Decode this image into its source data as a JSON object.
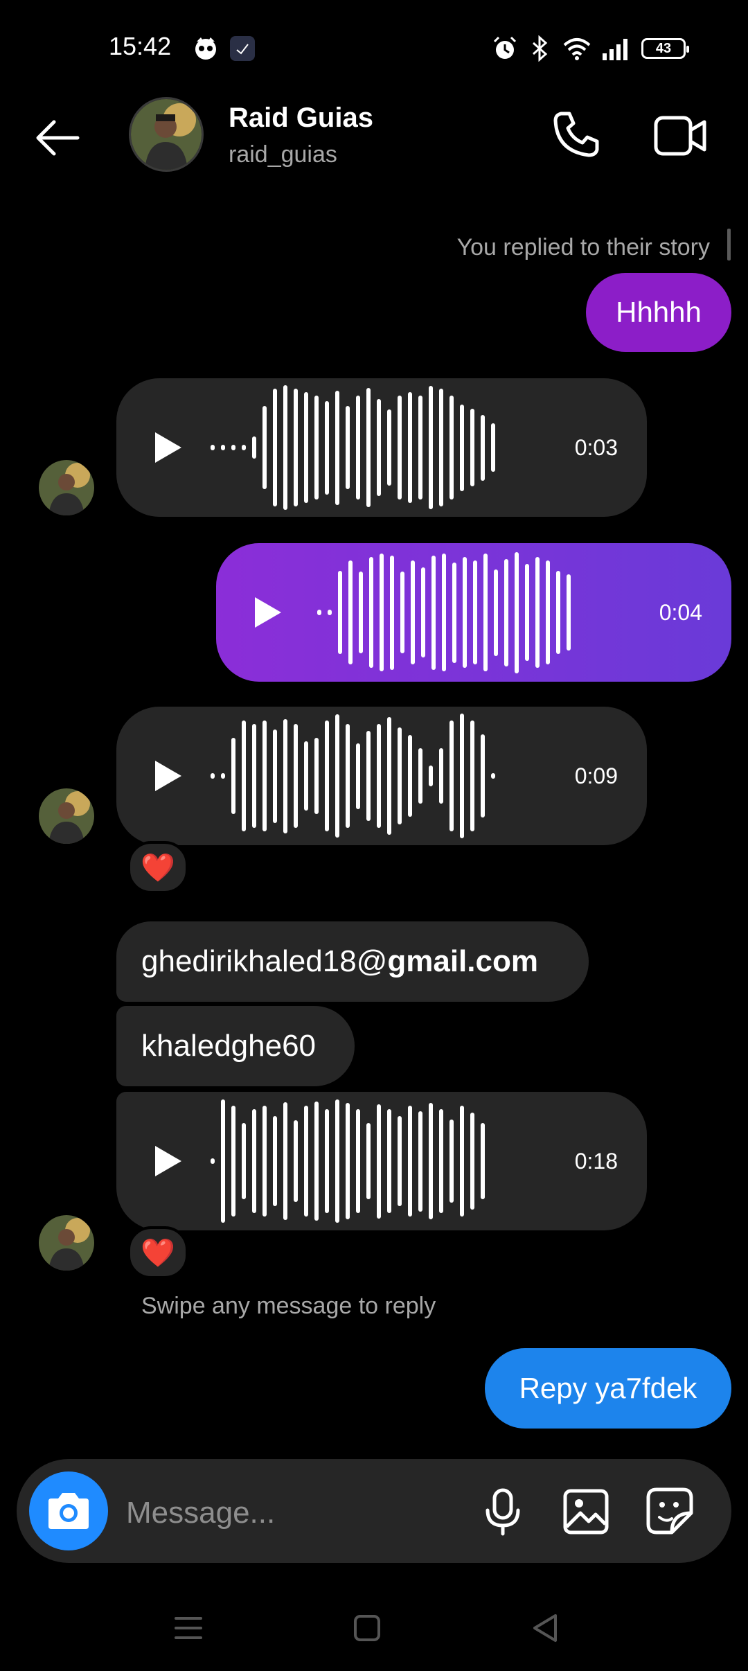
{
  "status_bar": {
    "time": "15:42",
    "battery": "43",
    "icons": [
      "app-notification-icon",
      "calendar-notification-icon",
      "alarm-icon",
      "bluetooth-icon",
      "wifi-icon",
      "signal-icon",
      "battery-icon"
    ]
  },
  "header": {
    "name": "Raid Guias",
    "username": "raid_guias",
    "icons": [
      "back-arrow-icon",
      "phone-call-icon",
      "video-call-icon"
    ]
  },
  "thread": {
    "story_reply_note": "You replied to their story",
    "messages": [
      {
        "sender": "me",
        "type": "text",
        "text": "Hhhhh",
        "color": "#8c1ec8"
      },
      {
        "sender": "them",
        "type": "voice",
        "duration": "0:03"
      },
      {
        "sender": "me",
        "type": "voice",
        "duration": "0:04",
        "color": "#7434d8"
      },
      {
        "sender": "them",
        "type": "voice",
        "duration": "0:09",
        "reaction": "❤️"
      },
      {
        "sender": "them",
        "type": "text",
        "text_prefix": "ghedirikhaled18@",
        "text_bold": "gmail.com"
      },
      {
        "sender": "them",
        "type": "text",
        "text": "khaledghe60"
      },
      {
        "sender": "them",
        "type": "voice",
        "duration": "0:18",
        "reaction": "❤️"
      },
      {
        "sender": "me",
        "type": "text",
        "text": "Repy ya7fdek",
        "color": "#1d84ec"
      }
    ],
    "swipe_hint": "Swipe any message to reply"
  },
  "composer": {
    "placeholder": "Message...",
    "icons": [
      "camera-icon",
      "microphone-icon",
      "gallery-icon",
      "sticker-icon"
    ]
  },
  "nav_bar": {
    "icons": [
      "menu-icon",
      "home-square-icon",
      "back-triangle-icon"
    ]
  },
  "colors": {
    "background": "#000000",
    "incoming_bubble": "#262626",
    "accent_blue": "#1f8bff"
  }
}
